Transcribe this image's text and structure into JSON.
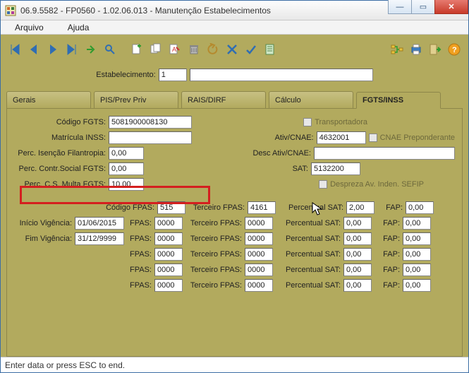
{
  "window": {
    "title": "06.9.5582 - FP0560 - 1.02.06.013 - Manutenção Estabelecimentos"
  },
  "menu": {
    "file": "Arquivo",
    "help": "Ajuda"
  },
  "estab": {
    "label": "Estabelecimento:",
    "code": "1",
    "name": ""
  },
  "tabs": {
    "t1": "Gerais",
    "t2": "PIS/Prev Priv",
    "t3": "RAIS/DIRF",
    "t4": "Cálculo",
    "t5": "FGTS/INSS"
  },
  "upper": {
    "codigo_fgts_lbl": "Código FGTS:",
    "codigo_fgts": "5081900008130",
    "matricula_inss_lbl": "Matrícula INSS:",
    "matricula_inss": "",
    "perc_isencao_lbl": "Perc. Isenção Filantropia:",
    "perc_isencao": "0,00",
    "perc_contr_lbl": "Perc. Contr.Social FGTS:",
    "perc_contr": "0,00",
    "perc_multa_lbl": "Perc. C.S. Multa FGTS:",
    "perc_multa": "10,00",
    "transportadora": "Transportadora",
    "ativ_cnae_lbl": "Ativ/CNAE:",
    "ativ_cnae": "4632001",
    "cnae_prep": "CNAE Preponderante",
    "desc_ativ_lbl": "Desc Ativ/CNAE:",
    "desc_ativ": "",
    "sat_lbl": "SAT:",
    "sat": "5132200",
    "despreza": "Despreza Av. Inden. SEFIP"
  },
  "grid": {
    "codigo_fpas_lbl": "Código FPAS:",
    "inicio_lbl": "Início Vigência:",
    "fim_lbl": "Fim Vigência:",
    "fpas_lbl": "FPAS:",
    "terceiro_lbl": "Terceiro FPAS:",
    "percsat_lbl": "Percentual SAT:",
    "fap_lbl": "FAP:",
    "rows": [
      {
        "c2": "",
        "fpas": "515",
        "terc": "4161",
        "sat": "2,00",
        "fap": "0,00"
      },
      {
        "c1lbl": "Início Vigência:",
        "c2": "01/06/2015",
        "fpas": "0000",
        "terc": "0000",
        "sat": "0,00",
        "fap": "0,00"
      },
      {
        "c1lbl": "Fim Vigência:",
        "c2": "31/12/9999",
        "fpas": "0000",
        "terc": "0000",
        "sat": "0,00",
        "fap": "0,00"
      },
      {
        "c2": "",
        "fpas": "0000",
        "terc": "0000",
        "sat": "0,00",
        "fap": "0,00"
      },
      {
        "c2": "",
        "fpas": "0000",
        "terc": "0000",
        "sat": "0,00",
        "fap": "0,00"
      },
      {
        "c2": "",
        "fpas": "0000",
        "terc": "0000",
        "sat": "0,00",
        "fap": "0,00"
      }
    ]
  },
  "status": "Enter data or press ESC to end."
}
